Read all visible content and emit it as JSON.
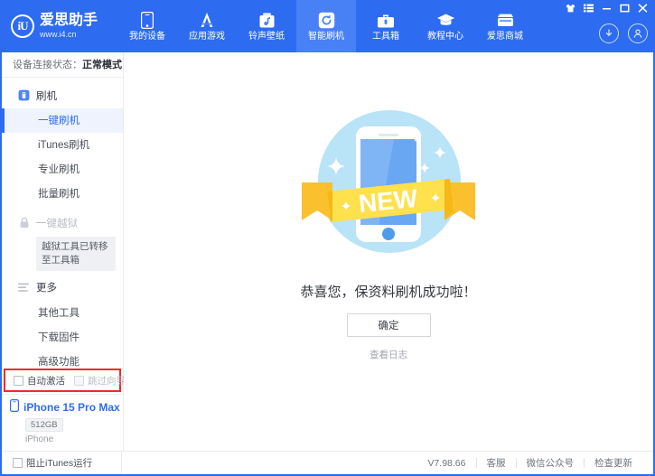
{
  "window": {
    "controls": [
      {
        "name": "skin-icon",
        "title": "换肤"
      },
      {
        "name": "menu-icon",
        "title": "主菜单"
      },
      {
        "name": "minimize-icon",
        "title": "最小化"
      },
      {
        "name": "maximize-icon",
        "title": "最大化"
      },
      {
        "name": "close-icon",
        "title": "关闭"
      }
    ]
  },
  "brand": {
    "mark": "iU",
    "name": "爱思助手",
    "url": "www.i4.cn"
  },
  "nav": {
    "items": [
      {
        "label": "我的设备",
        "icon": "phone-icon",
        "active": false
      },
      {
        "label": "应用游戏",
        "icon": "appstore-icon",
        "active": false
      },
      {
        "label": "铃声壁纸",
        "icon": "music-box-icon",
        "active": false
      },
      {
        "label": "智能刷机",
        "icon": "refresh-icon",
        "active": true
      },
      {
        "label": "工具箱",
        "icon": "toolbox-icon",
        "active": false
      },
      {
        "label": "教程中心",
        "icon": "graduation-cap-icon",
        "active": false
      },
      {
        "label": "爱思商城",
        "icon": "store-icon",
        "active": false
      }
    ],
    "download_icon": "download-icon",
    "account_icon": "account-icon"
  },
  "sidebar": {
    "connection_label": "设备连接状态：",
    "connection_value": "正常模式",
    "groups": [
      {
        "label": "刷机",
        "icon": "flash-icon",
        "locked": false,
        "items": [
          {
            "label": "一键刷机",
            "active": true
          },
          {
            "label": "iTunes刷机",
            "active": false
          },
          {
            "label": "专业刷机",
            "active": false
          },
          {
            "label": "批量刷机",
            "active": false
          }
        ]
      },
      {
        "label": "一键越狱",
        "icon": "lock-icon",
        "locked": true,
        "tooltip": "越狱工具已转移至工具箱",
        "items": []
      },
      {
        "label": "更多",
        "icon": "list-icon",
        "locked": false,
        "items": [
          {
            "label": "其他工具",
            "active": false
          },
          {
            "label": "下载固件",
            "active": false
          },
          {
            "label": "高级功能",
            "active": false
          }
        ]
      }
    ],
    "options": [
      {
        "label": "自动激活",
        "checked": false,
        "disabled": false
      },
      {
        "label": "跳过向导",
        "checked": false,
        "disabled": true
      }
    ],
    "device": {
      "name": "iPhone 15 Pro Max",
      "capacity": "512GB",
      "type": "iPhone",
      "icon": "phone-small-icon"
    }
  },
  "content": {
    "badge_text": "NEW",
    "message": "恭喜您，保资料刷机成功啦！",
    "confirm_button": "确定",
    "log_link": "查看日志"
  },
  "footer": {
    "block_itunes": {
      "label": "阻止iTunes运行",
      "checked": false
    },
    "version": "V7.98.66",
    "links": [
      "客服",
      "微信公众号",
      "检查更新"
    ]
  },
  "colors": {
    "brand_blue": "#2d6cf0",
    "active_nav": "#4880f5",
    "sidebar_active_bg": "#eef3fe",
    "highlight_red": "#ee2b2b",
    "illus_circle": "#b9e3f7",
    "ribbon_yellow": "#ffe04d",
    "ribbon_yellow_dark": "#fbc02d",
    "phone_screen": "#7fb5f5"
  }
}
